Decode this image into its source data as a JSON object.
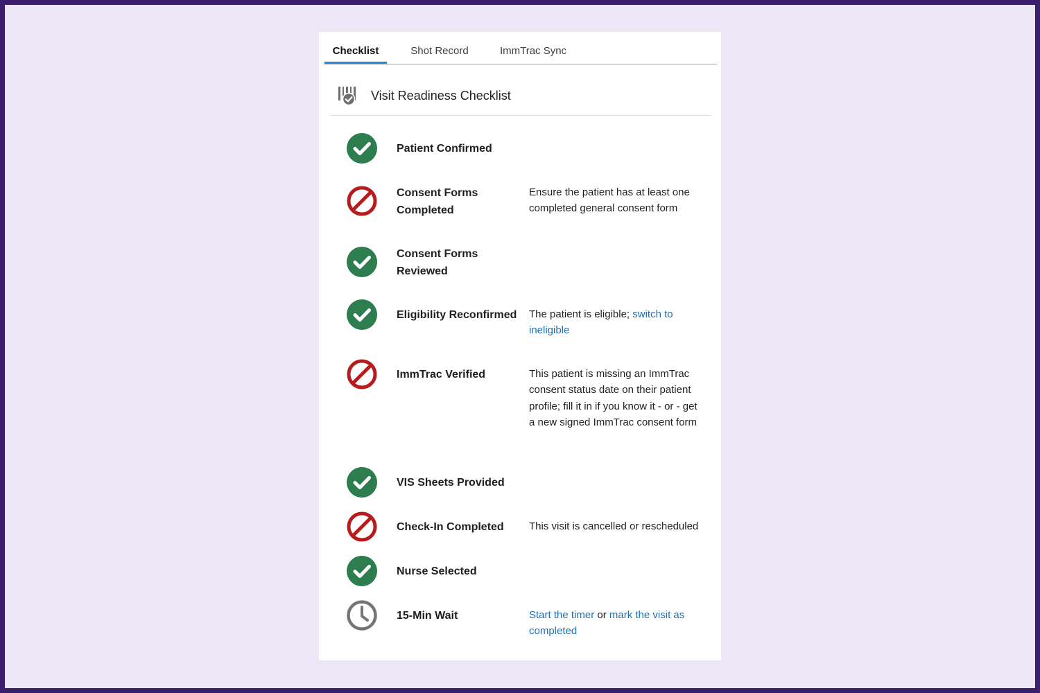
{
  "tabs": [
    "Checklist",
    "Shot Record",
    "ImmTrac Sync"
  ],
  "active_tab": "Checklist",
  "header": {
    "title": "Visit Readiness Checklist",
    "icon": "barcode-check-icon"
  },
  "colors": {
    "pass": "#2e7d4f",
    "fail": "#b71c1c",
    "pending": "#757575",
    "link": "#1f6fb5",
    "tab_underline": "#2b88d8"
  },
  "items": [
    {
      "label": "Patient Confirmed",
      "status": "pass"
    },
    {
      "label": "Consent Forms Completed",
      "status": "fail",
      "note": "Ensure the patient has at least one completed general consent form"
    },
    {
      "label": "Consent Forms Reviewed",
      "status": "pass"
    },
    {
      "label": "Eligibility Reconfirmed",
      "status": "pass",
      "note_prefix": "The patient is eligible; ",
      "note_link": "switch to ineligible"
    },
    {
      "label": "ImmTrac Verified",
      "status": "fail",
      "note": "This patient is missing an ImmTrac consent status date on their patient profile; fill it in if you know it - or - get a new signed ImmTrac consent form"
    },
    {
      "label": "VIS Sheets Provided",
      "status": "pass"
    },
    {
      "label": "Check-In Completed",
      "status": "fail",
      "note": "This visit is cancelled or rescheduled"
    },
    {
      "label": "Nurse Selected",
      "status": "pass"
    },
    {
      "label": "15-Min Wait",
      "status": "pending",
      "note_link1": "Start the timer",
      "note_middle": " or ",
      "note_link2": "mark the visit as completed"
    }
  ]
}
